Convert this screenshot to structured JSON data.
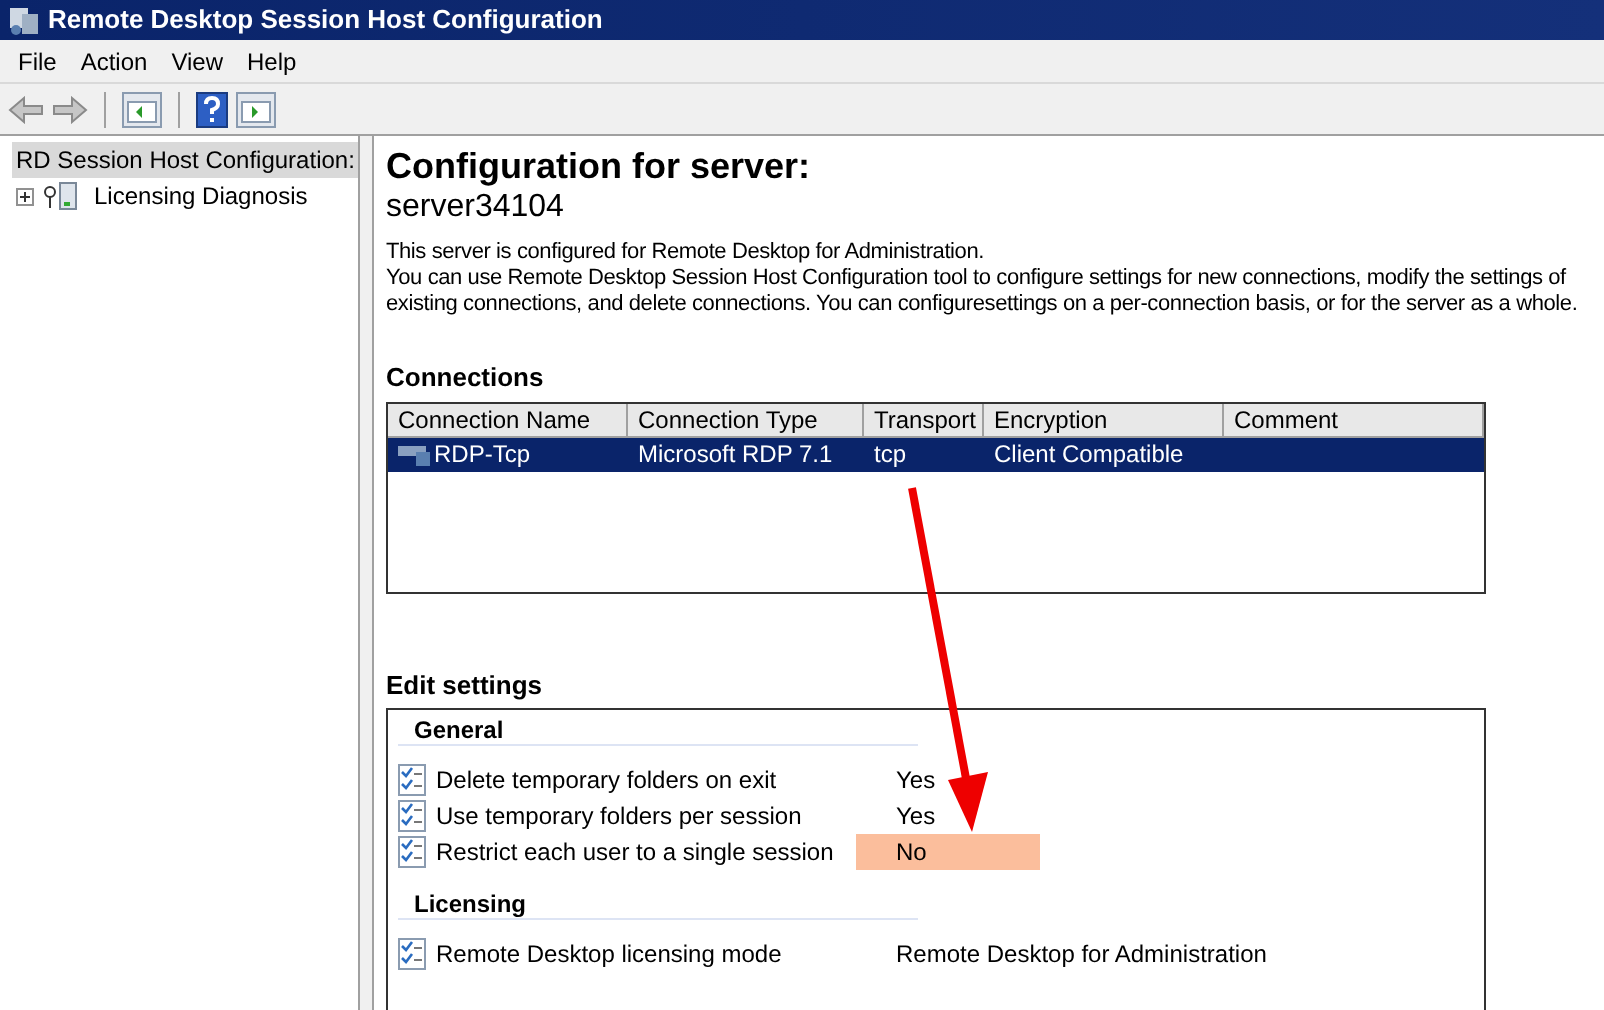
{
  "window": {
    "title": "Remote Desktop Session Host Configuration"
  },
  "menu": [
    "File",
    "Action",
    "View",
    "Help"
  ],
  "tree": [
    {
      "label": "RD Session Host Configuration:",
      "selected": true,
      "children": [
        {
          "label": "Licensing Diagnosis",
          "selected": false,
          "expanded": false
        }
      ]
    }
  ],
  "heading": "Configuration for server:",
  "server": "server34104",
  "description": [
    "This server is configured for Remote Desktop for Administration.",
    "You can use Remote Desktop Session Host Configuration tool to configure settings for new connections, modify the settings of existing connections, and delete connections. You can configuresettings on a per-connection basis, or for the server as a whole."
  ],
  "connections": {
    "title": "Connections",
    "columns": [
      "Connection Name",
      "Connection Type",
      "Transport",
      "Encryption",
      "Comment"
    ],
    "rows": [
      {
        "cells": [
          "RDP-Tcp",
          "Microsoft RDP 7.1",
          "tcp",
          "Client Compatible",
          ""
        ],
        "selected": true
      }
    ]
  },
  "edit_settings": {
    "title": "Edit settings",
    "groups": [
      {
        "title": "General",
        "items": [
          {
            "label": "Delete temporary folders on exit",
            "value": "Yes",
            "highlighted": false
          },
          {
            "label": "Use temporary folders per session",
            "value": "Yes",
            "highlighted": false
          },
          {
            "label": "Restrict each user to a single session",
            "value": "No",
            "highlighted": true
          }
        ]
      },
      {
        "title": "Licensing",
        "items": [
          {
            "label": "Remote Desktop licensing mode",
            "value": "Remote Desktop for Administration",
            "highlighted": false
          }
        ]
      }
    ]
  }
}
